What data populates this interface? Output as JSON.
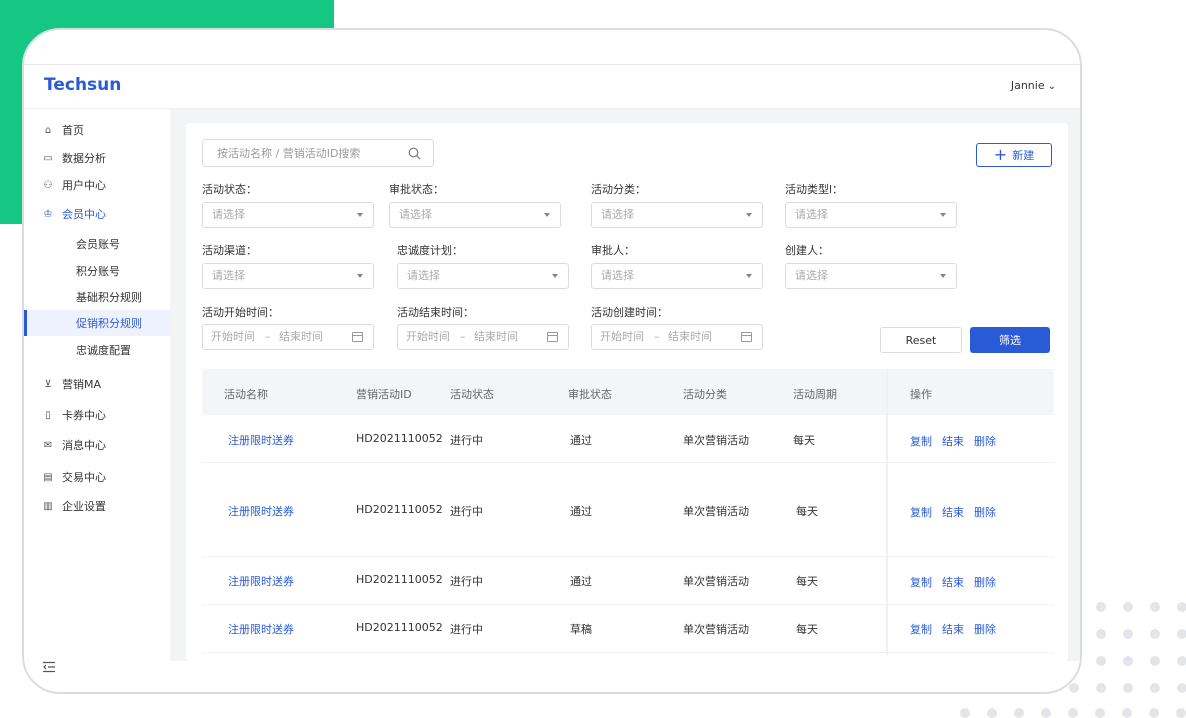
{
  "app": {
    "brand": "Techsun",
    "user": "Jannie"
  },
  "sidebar": {
    "items": [
      {
        "label": "首页",
        "icon": "home-icon"
      },
      {
        "label": "数据分析",
        "icon": "chart-icon"
      },
      {
        "label": "用户中心",
        "icon": "users-icon"
      },
      {
        "label": "会员中心",
        "icon": "member-icon",
        "active": true
      },
      {
        "label": "营销MA",
        "icon": "cart-icon"
      },
      {
        "label": "卡券中心",
        "icon": "ticket-icon"
      },
      {
        "label": "消息中心",
        "icon": "mail-icon"
      },
      {
        "label": "交易中心",
        "icon": "card-icon"
      },
      {
        "label": "企业设置",
        "icon": "building-icon"
      }
    ],
    "sub_items": [
      {
        "label": "会员账号"
      },
      {
        "label": "积分账号"
      },
      {
        "label": "基础积分规则"
      },
      {
        "label": "促销积分规则",
        "selected": true
      },
      {
        "label": "忠诚度配置"
      }
    ]
  },
  "toolbar": {
    "search_placeholder": "按活动名称 / 营销活动ID搜索",
    "new_label": "新建"
  },
  "filters": {
    "status": {
      "label": "活动状态：",
      "placeholder": "请选择"
    },
    "approval": {
      "label": "审批状态：",
      "placeholder": "请选择"
    },
    "category": {
      "label": "活动分类：",
      "placeholder": "请选择"
    },
    "type": {
      "label": "活动类型l：",
      "placeholder": "请选择"
    },
    "channel": {
      "label": "活动渠道：",
      "placeholder": "请选择"
    },
    "loyalty": {
      "label": "忠诚度计划：",
      "placeholder": "请选择"
    },
    "approver": {
      "label": "审批人：",
      "placeholder": "请选择"
    },
    "creator": {
      "label": "创建人：",
      "placeholder": "请选择"
    },
    "start_time": {
      "label": "活动开始时间：",
      "start": "开始时间",
      "sep": "–",
      "end": "结束时间"
    },
    "end_time": {
      "label": "活动结束时间：",
      "start": "开始时间",
      "sep": "–",
      "end": "结束时间"
    },
    "created_time": {
      "label": "活动创建时间：",
      "start": "开始时间",
      "sep": "–",
      "end": "结束时间"
    },
    "reset_label": "Reset",
    "filter_label": "筛选"
  },
  "table": {
    "headers": [
      "活动名称",
      "营销活动ID",
      "活动状态",
      "审批状态",
      "活动分类",
      "活动周期",
      "操作"
    ],
    "rows": [
      {
        "name": "注册限时送券",
        "id": "HD2021110052",
        "status": "进行中",
        "approval": "通过",
        "category": "单次营销活动",
        "period": "每天"
      },
      {
        "name": "注册限时送券",
        "id": "HD2021110052",
        "status": "进行中",
        "approval": "通过",
        "category": "单次营销活动",
        "period": "每天"
      },
      {
        "name": "注册限时送券",
        "id": "HD2021110052",
        "status": "进行中",
        "approval": "通过",
        "category": "单次营销活动",
        "period": "每天"
      },
      {
        "name": "注册限时送券",
        "id": "HD2021110052",
        "status": "进行中",
        "approval": "草稿",
        "category": "单次营销活动",
        "period": "每天"
      }
    ],
    "actions": {
      "copy": "复制",
      "end": "结束",
      "delete": "删除"
    }
  },
  "colors": {
    "accent": "#2a5bd7",
    "brand_green": "#16c784"
  }
}
